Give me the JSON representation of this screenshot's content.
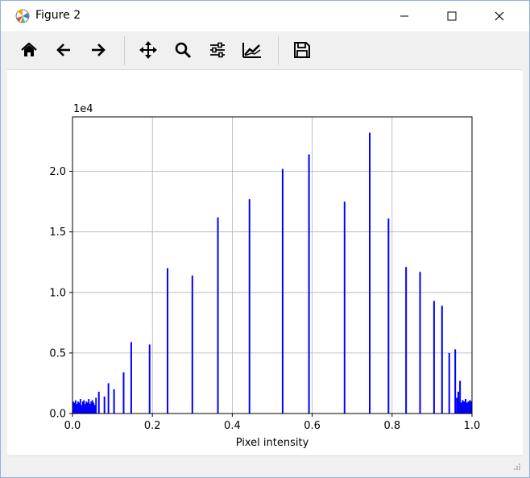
{
  "window": {
    "title": "Figure 2"
  },
  "toolbar": {
    "tools": [
      {
        "name": "home-button",
        "icon": "home-icon"
      },
      {
        "name": "back-button",
        "icon": "arrow-left-icon"
      },
      {
        "name": "forward-button",
        "icon": "arrow-right-icon"
      },
      {
        "name": "pan-button",
        "icon": "move-icon"
      },
      {
        "name": "zoom-button",
        "icon": "magnifier-icon"
      },
      {
        "name": "subplots-button",
        "icon": "sliders-icon"
      },
      {
        "name": "customize-button",
        "icon": "line-chart-icon"
      },
      {
        "name": "save-button",
        "icon": "floppy-disk-icon"
      }
    ]
  },
  "chart_data": {
    "type": "bar",
    "title": "",
    "xlabel": "Pixel intensity",
    "ylabel": "",
    "y_offset_label": "1e4",
    "xlim": [
      0.0,
      1.0
    ],
    "ylim": [
      0,
      24500
    ],
    "grid": true,
    "bar_color": "#0000ff",
    "xticks": [
      "0.0",
      "0.2",
      "0.4",
      "0.6",
      "0.8",
      "1.0"
    ],
    "yticks": [
      "0.0",
      "0.5",
      "1.0",
      "1.5",
      "2.0"
    ],
    "spikes": {
      "x": [
        0.066,
        0.08,
        0.09,
        0.104,
        0.128,
        0.147,
        0.193,
        0.238,
        0.3,
        0.364,
        0.443,
        0.526,
        0.592,
        0.681,
        0.744,
        0.791,
        0.835,
        0.87,
        0.905,
        0.925,
        0.943,
        0.958,
        0.97
      ],
      "values": [
        1800,
        1400,
        2500,
        2000,
        3400,
        5900,
        5700,
        12000,
        11400,
        16200,
        17700,
        20200,
        21400,
        17500,
        23200,
        16100,
        12100,
        11700,
        9300,
        8900,
        5000,
        5300,
        2700
      ]
    },
    "low_band_left": {
      "x_range": [
        0.0,
        0.06
      ],
      "values": [
        1000,
        900,
        1100,
        800,
        1000,
        900,
        1200,
        700,
        1000,
        1100,
        800,
        1000,
        900,
        1200,
        800,
        1000,
        1100,
        900,
        700,
        1300
      ]
    },
    "low_band_right": {
      "x_range": [
        0.96,
        1.0
      ],
      "values": [
        1300,
        1800,
        1000,
        900,
        1100,
        1000,
        1200,
        900,
        1000,
        1100,
        1000
      ]
    }
  }
}
